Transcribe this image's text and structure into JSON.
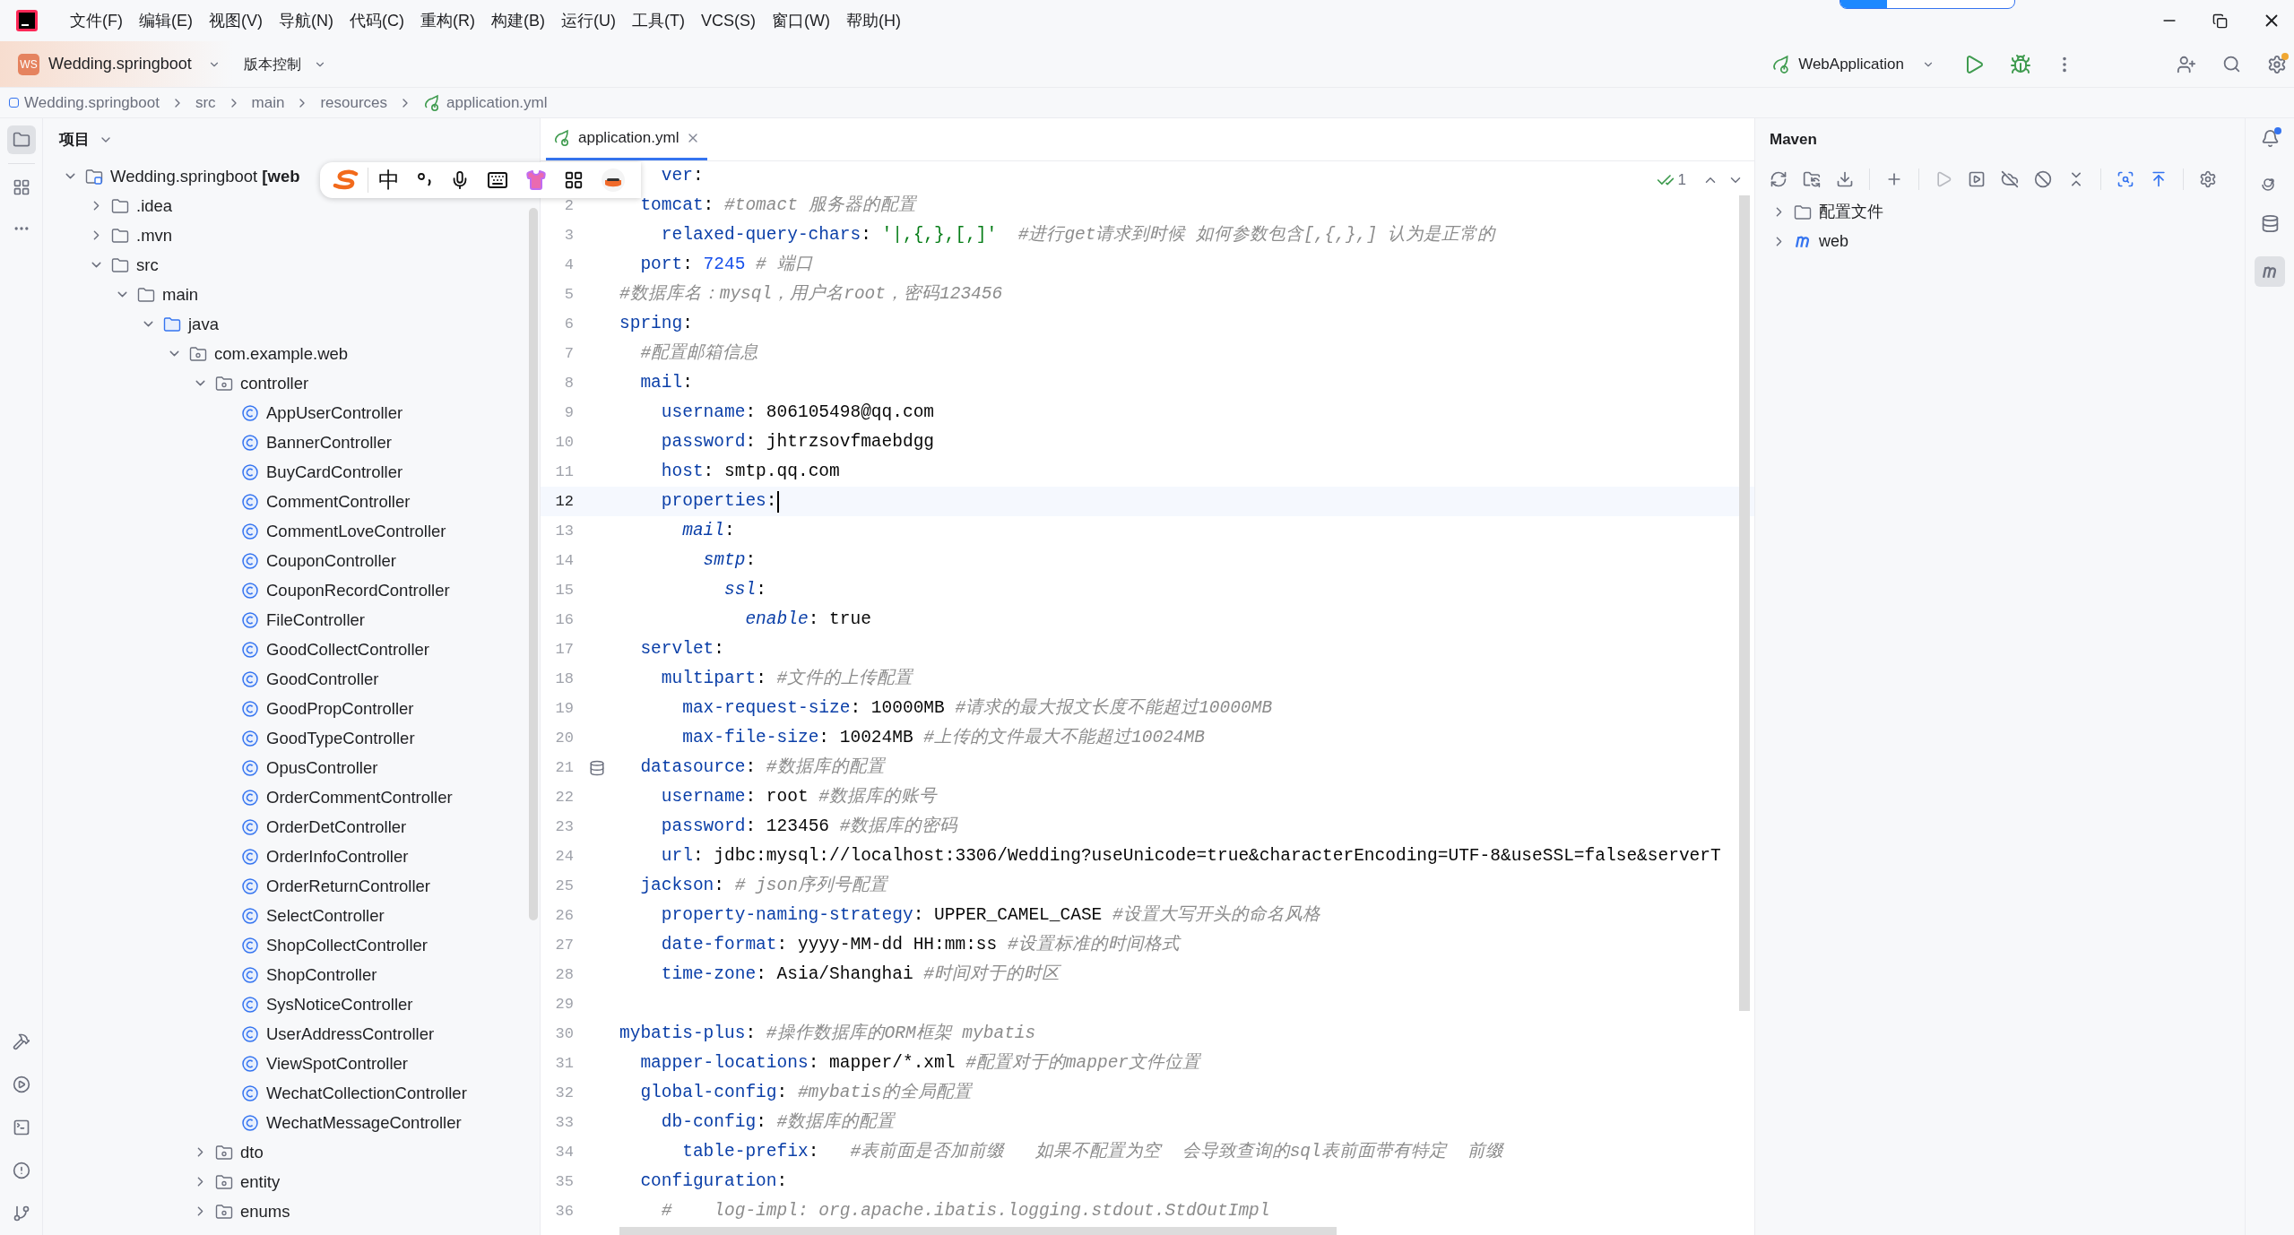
{
  "menu": [
    "文件(F)",
    "编辑(E)",
    "视图(V)",
    "导航(N)",
    "代码(C)",
    "重构(R)",
    "构建(B)",
    "运行(U)",
    "工具(T)",
    "VCS(S)",
    "窗口(W)",
    "帮助(H)"
  ],
  "project_switcher": {
    "badge": "WS",
    "name": "Wedding.springboot"
  },
  "vcs_menu": "版本控制",
  "run_config": "WebApplication",
  "breadcrumb": [
    {
      "label": "Wedding.springboot",
      "kind": "module"
    },
    {
      "label": "src",
      "kind": "dir"
    },
    {
      "label": "main",
      "kind": "dir"
    },
    {
      "label": "resources",
      "kind": "dir"
    },
    {
      "label": "application.yml",
      "kind": "file"
    }
  ],
  "project_panel": {
    "title": "项目",
    "tree": [
      {
        "label": "Wedding.springboot **[web**",
        "kind": "module",
        "expanded": true,
        "children": [
          {
            "label": ".idea",
            "kind": "folder",
            "expanded": false
          },
          {
            "label": ".mvn",
            "kind": "folder",
            "expanded": false
          },
          {
            "label": "src",
            "kind": "folder",
            "expanded": true,
            "children": [
              {
                "label": "main",
                "kind": "folder",
                "expanded": true,
                "children": [
                  {
                    "label": "java",
                    "kind": "source",
                    "expanded": true,
                    "children": [
                      {
                        "label": "com.example.web",
                        "kind": "package",
                        "expanded": true,
                        "children": [
                          {
                            "label": "controller",
                            "kind": "package",
                            "expanded": true,
                            "children": [
                              {
                                "label": "AppUserController",
                                "kind": "class"
                              },
                              {
                                "label": "BannerController",
                                "kind": "class"
                              },
                              {
                                "label": "BuyCardController",
                                "kind": "class"
                              },
                              {
                                "label": "CommentController",
                                "kind": "class"
                              },
                              {
                                "label": "CommentLoveController",
                                "kind": "class"
                              },
                              {
                                "label": "CouponController",
                                "kind": "class"
                              },
                              {
                                "label": "CouponRecordController",
                                "kind": "class"
                              },
                              {
                                "label": "FileController",
                                "kind": "class"
                              },
                              {
                                "label": "GoodCollectController",
                                "kind": "class"
                              },
                              {
                                "label": "GoodController",
                                "kind": "class"
                              },
                              {
                                "label": "GoodPropController",
                                "kind": "class"
                              },
                              {
                                "label": "GoodTypeController",
                                "kind": "class"
                              },
                              {
                                "label": "OpusController",
                                "kind": "class"
                              },
                              {
                                "label": "OrderCommentController",
                                "kind": "class"
                              },
                              {
                                "label": "OrderDetController",
                                "kind": "class"
                              },
                              {
                                "label": "OrderInfoController",
                                "kind": "class"
                              },
                              {
                                "label": "OrderReturnController",
                                "kind": "class"
                              },
                              {
                                "label": "SelectController",
                                "kind": "class"
                              },
                              {
                                "label": "ShopCollectController",
                                "kind": "class"
                              },
                              {
                                "label": "ShopController",
                                "kind": "class"
                              },
                              {
                                "label": "SysNoticeController",
                                "kind": "class"
                              },
                              {
                                "label": "UserAddressController",
                                "kind": "class"
                              },
                              {
                                "label": "ViewSpotController",
                                "kind": "class"
                              },
                              {
                                "label": "WechatCollectionController",
                                "kind": "class"
                              },
                              {
                                "label": "WechatMessageController",
                                "kind": "class"
                              }
                            ]
                          },
                          {
                            "label": "dto",
                            "kind": "package",
                            "expanded": false
                          },
                          {
                            "label": "entity",
                            "kind": "package",
                            "expanded": false
                          },
                          {
                            "label": "enums",
                            "kind": "package",
                            "expanded": false
                          }
                        ]
                      }
                    ]
                  }
                ]
              }
            ]
          }
        ]
      }
    ]
  },
  "ime_toolbar": {
    "mode": "中"
  },
  "editor": {
    "tabs": [
      {
        "label": "application.yml",
        "selected": true
      }
    ],
    "problems": "1",
    "lines": [
      {
        "current": false,
        "marker": false,
        "tokens": [
          {
            "kind": "key",
            "text": "    ver"
          },
          {
            "kind": "plain",
            "text": ":"
          }
        ]
      },
      {
        "number": "2",
        "current": false,
        "marker": false,
        "tokens": [
          {
            "kind": "key",
            "text": "  tomcat"
          },
          {
            "kind": "plain",
            "text": ": "
          },
          {
            "kind": "comment",
            "text": "#tomact 服务器的配置"
          }
        ]
      },
      {
        "number": "3",
        "current": false,
        "marker": false,
        "tokens": [
          {
            "kind": "key",
            "text": "    relaxed-query-chars"
          },
          {
            "kind": "plain",
            "text": ": "
          },
          {
            "kind": "string",
            "text": "'|,{,},[,]'"
          },
          {
            "kind": "comment",
            "text": "  #进行get请求到时候 如何参数包含[,{,},] 认为是正常的"
          }
        ]
      },
      {
        "number": "4",
        "current": false,
        "marker": false,
        "tokens": [
          {
            "kind": "key",
            "text": "  port"
          },
          {
            "kind": "plain",
            "text": ": "
          },
          {
            "kind": "number",
            "text": "7245"
          },
          {
            "kind": "comment",
            "text": " # 端口"
          }
        ]
      },
      {
        "number": "5",
        "current": false,
        "marker": false,
        "tokens": [
          {
            "kind": "comment",
            "text": "#数据库名：mysql，用户名root，密码123456"
          }
        ]
      },
      {
        "number": "6",
        "current": false,
        "marker": false,
        "tokens": [
          {
            "kind": "key",
            "text": "spring"
          },
          {
            "kind": "plain",
            "text": ":"
          }
        ]
      },
      {
        "number": "7",
        "current": false,
        "marker": false,
        "tokens": [
          {
            "kind": "comment",
            "text": "  #配置邮箱信息"
          }
        ]
      },
      {
        "number": "8",
        "current": false,
        "marker": false,
        "tokens": [
          {
            "kind": "key",
            "text": "  mail"
          },
          {
            "kind": "plain",
            "text": ":"
          }
        ]
      },
      {
        "number": "9",
        "current": false,
        "marker": false,
        "tokens": [
          {
            "kind": "key",
            "text": "    username"
          },
          {
            "kind": "plain",
            "text": ": 806105498@qq.com"
          }
        ]
      },
      {
        "number": "10",
        "current": false,
        "marker": false,
        "tokens": [
          {
            "kind": "key",
            "text": "    password"
          },
          {
            "kind": "plain",
            "text": ": jhtrzsovfmaebdgg"
          }
        ]
      },
      {
        "number": "11",
        "current": false,
        "marker": false,
        "tokens": [
          {
            "kind": "key",
            "text": "    host"
          },
          {
            "kind": "plain",
            "text": ": smtp.qq.com"
          }
        ]
      },
      {
        "number": "12",
        "current": true,
        "marker": false,
        "tokens": [
          {
            "kind": "key",
            "text": "    properties"
          },
          {
            "kind": "plain",
            "text": ":"
          }
        ]
      },
      {
        "number": "13",
        "current": false,
        "marker": false,
        "tokens": [
          {
            "kind": "ikey",
            "text": "      mail"
          },
          {
            "kind": "plain",
            "text": ":"
          }
        ]
      },
      {
        "number": "14",
        "current": false,
        "marker": false,
        "tokens": [
          {
            "kind": "ikey",
            "text": "        smtp"
          },
          {
            "kind": "plain",
            "text": ":"
          }
        ]
      },
      {
        "number": "15",
        "current": false,
        "marker": false,
        "tokens": [
          {
            "kind": "ikey",
            "text": "          ssl"
          },
          {
            "kind": "plain",
            "text": ":"
          }
        ]
      },
      {
        "number": "16",
        "current": false,
        "marker": false,
        "tokens": [
          {
            "kind": "ikey",
            "text": "            enable"
          },
          {
            "kind": "plain",
            "text": ": true"
          }
        ]
      },
      {
        "number": "17",
        "current": false,
        "marker": false,
        "tokens": [
          {
            "kind": "key",
            "text": "  servlet"
          },
          {
            "kind": "plain",
            "text": ":"
          }
        ]
      },
      {
        "number": "18",
        "current": false,
        "marker": false,
        "tokens": [
          {
            "kind": "key",
            "text": "    multipart"
          },
          {
            "kind": "plain",
            "text": ": "
          },
          {
            "kind": "comment",
            "text": "#文件的上传配置"
          }
        ]
      },
      {
        "number": "19",
        "current": false,
        "marker": false,
        "tokens": [
          {
            "kind": "key",
            "text": "      max-request-size"
          },
          {
            "kind": "plain",
            "text": ": 10000MB "
          },
          {
            "kind": "comment",
            "text": "#请求的最大报文长度不能超过10000MB"
          }
        ]
      },
      {
        "number": "20",
        "current": false,
        "marker": false,
        "tokens": [
          {
            "kind": "key",
            "text": "      max-file-size"
          },
          {
            "kind": "plain",
            "text": ": 10024MB "
          },
          {
            "kind": "comment",
            "text": "#上传的文件最大不能超过10024MB"
          }
        ]
      },
      {
        "number": "21",
        "current": false,
        "marker": true,
        "tokens": [
          {
            "kind": "key",
            "text": "  datasource"
          },
          {
            "kind": "plain",
            "text": ": "
          },
          {
            "kind": "comment",
            "text": "#数据库的配置"
          }
        ]
      },
      {
        "number": "22",
        "current": false,
        "marker": false,
        "tokens": [
          {
            "kind": "key",
            "text": "    username"
          },
          {
            "kind": "plain",
            "text": ": root "
          },
          {
            "kind": "comment",
            "text": "#数据库的账号"
          }
        ]
      },
      {
        "number": "23",
        "current": false,
        "marker": false,
        "tokens": [
          {
            "kind": "key",
            "text": "    password"
          },
          {
            "kind": "plain",
            "text": ": 123456 "
          },
          {
            "kind": "comment",
            "text": "#数据库的密码"
          }
        ]
      },
      {
        "number": "24",
        "current": false,
        "marker": false,
        "tokens": [
          {
            "kind": "key",
            "text": "    url"
          },
          {
            "kind": "plain",
            "text": ": jdbc:mysql://localhost:3306/Wedding?useUnicode=true&characterEncoding=UTF-8&useSSL=false&serverT"
          }
        ]
      },
      {
        "number": "25",
        "current": false,
        "marker": false,
        "tokens": [
          {
            "kind": "key",
            "text": "  jackson"
          },
          {
            "kind": "plain",
            "text": ": "
          },
          {
            "kind": "comment",
            "text": "# json序列号配置"
          }
        ]
      },
      {
        "number": "26",
        "current": false,
        "marker": false,
        "tokens": [
          {
            "kind": "key",
            "text": "    property-naming-strategy"
          },
          {
            "kind": "plain",
            "text": ": UPPER_CAMEL_CASE "
          },
          {
            "kind": "comment",
            "text": "#设置大写开头的命名风格"
          }
        ]
      },
      {
        "number": "27",
        "current": false,
        "marker": false,
        "tokens": [
          {
            "kind": "key",
            "text": "    date-format"
          },
          {
            "kind": "plain",
            "text": ": yyyy-MM-dd HH:mm:ss "
          },
          {
            "kind": "comment",
            "text": "#设置标准的时间格式"
          }
        ]
      },
      {
        "number": "28",
        "current": false,
        "marker": false,
        "tokens": [
          {
            "kind": "key",
            "text": "    time-zone"
          },
          {
            "kind": "plain",
            "text": ": Asia/Shanghai "
          },
          {
            "kind": "comment",
            "text": "#时间对于的时区"
          }
        ]
      },
      {
        "number": "29",
        "current": false,
        "marker": false
      },
      {
        "number": "30",
        "current": false,
        "marker": false,
        "tokens": [
          {
            "kind": "key",
            "text": "mybatis-plus"
          },
          {
            "kind": "plain",
            "text": ": "
          },
          {
            "kind": "comment",
            "text": "#操作数据库的ORM框架 mybatis"
          }
        ]
      },
      {
        "number": "31",
        "current": false,
        "marker": false,
        "tokens": [
          {
            "kind": "key",
            "text": "  mapper-locations"
          },
          {
            "kind": "plain",
            "text": ": mapper/*.xml "
          },
          {
            "kind": "comment",
            "text": "#配置对于的mapper文件位置"
          }
        ]
      },
      {
        "number": "32",
        "current": false,
        "marker": false,
        "tokens": [
          {
            "kind": "key",
            "text": "  global-config"
          },
          {
            "kind": "plain",
            "text": ": "
          },
          {
            "kind": "comment",
            "text": "#mybatis的全局配置"
          }
        ]
      },
      {
        "number": "33",
        "current": false,
        "marker": false,
        "tokens": [
          {
            "kind": "key",
            "text": "    db-config"
          },
          {
            "kind": "plain",
            "text": ": "
          },
          {
            "kind": "comment",
            "text": "#数据库的配置"
          }
        ]
      },
      {
        "number": "34",
        "current": false,
        "marker": false,
        "tokens": [
          {
            "kind": "key",
            "text": "      table-prefix"
          },
          {
            "kind": "plain",
            "text": ": "
          },
          {
            "kind": "comment",
            "text": "  #表前面是否加前缀   如果不配置为空  会导致查询的sql表前面带有特定  前缀"
          }
        ]
      },
      {
        "number": "35",
        "current": false,
        "marker": false,
        "tokens": [
          {
            "kind": "key",
            "text": "  configuration"
          },
          {
            "kind": "plain",
            "text": ":"
          }
        ]
      },
      {
        "number": "36",
        "current": false,
        "marker": false,
        "tokens": [
          {
            "kind": "comment",
            "text": "    #    log-impl: org.apache.ibatis.logging.stdout.StdOutImpl"
          }
        ]
      }
    ]
  },
  "maven": {
    "title": "Maven",
    "tree": [
      {
        "label": "配置文件",
        "kind": "folder",
        "expanded": false
      },
      {
        "label": "web",
        "kind": "maven",
        "expanded": false
      }
    ]
  }
}
